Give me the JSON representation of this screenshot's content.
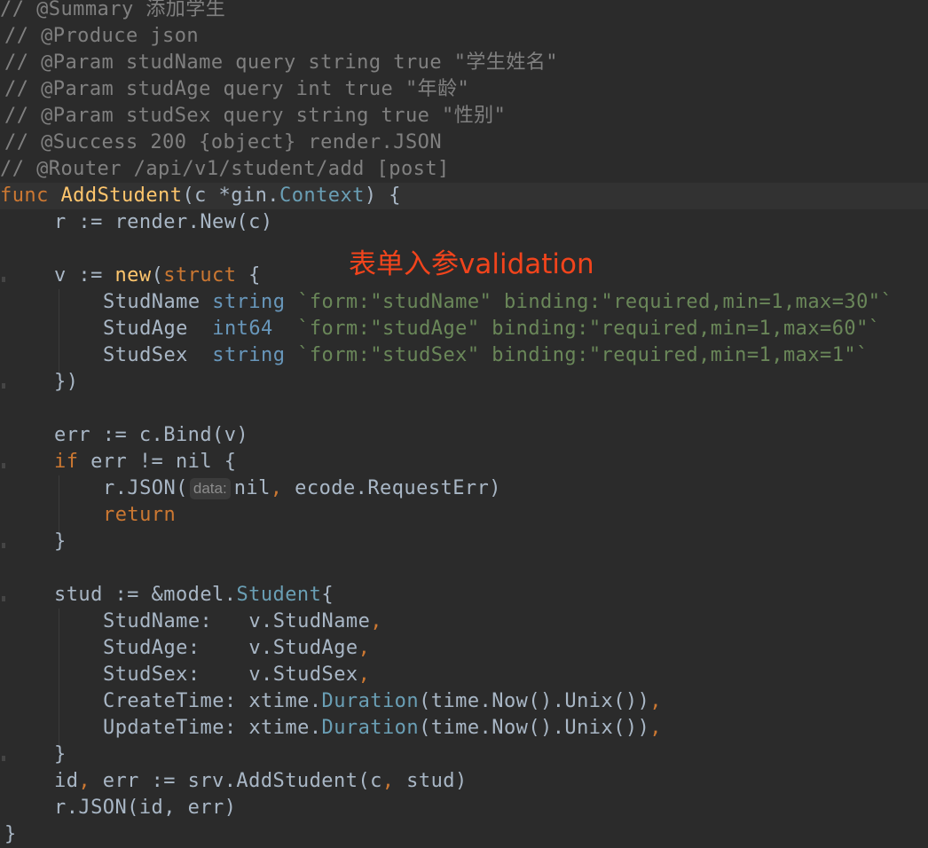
{
  "annotation": "表单入参validation",
  "comments": {
    "summary": "// @Summary 添加学生",
    "produce": "// @Produce json",
    "param_name": "// @Param studName query string true \"学生姓名\"",
    "param_age": "// @Param studAge query int true \"年龄\"",
    "param_sex": "// @Param studSex query string true \"性别\"",
    "success": "// @Success 200 {object} render.JSON",
    "router": "// @Router /api/v1/student/add [post]"
  },
  "code": {
    "func_kw": "func",
    "func_name": "AddStudent",
    "func_sig_1": "(c *gin.",
    "func_sig_type": "Context",
    "func_sig_2": ") {",
    "r_new": "r := render.New(c)",
    "v_prefix": "v := ",
    "new_kw": "new",
    "paren_open": "(",
    "struct_kw": "struct",
    "brace_open": " {",
    "f1_name": "StudName ",
    "f1_type": "string",
    "f1_tag": "`form:\"studName\" binding:\"required,min=1,max=30\"`",
    "f2_name": "StudAge  ",
    "f2_type": "int64",
    "f2_tag": "`form:\"studAge\" binding:\"required,min=1,max=60\"`",
    "f3_name": "StudSex  ",
    "f3_type": "string",
    "f3_tag": "`form:\"studSex\" binding:\"required,min=1,max=1\"`",
    "struct_close": "})",
    "err_bind": "err := c.Bind(v)",
    "if_kw": "if",
    "if_cond": " err != nil {",
    "json_call": "r.JSON(",
    "hint_data": "data:",
    "json_args_1": "nil",
    "comma": ",",
    "json_args_2": " ecode.RequestErr)",
    "return_kw": "return",
    "close_brace": "}",
    "stud_prefix": "stud := &model.",
    "stud_type": "Student",
    "stud_brace": "{",
    "a1_key": "StudName:   ",
    "a1_val": "v.StudName",
    "a2_key": "StudAge:    ",
    "a2_val": "v.StudAge",
    "a3_key": "StudSex:    ",
    "a3_val": "v.StudSex",
    "a4_key": "CreateTime: xtime.",
    "a4_fn": "Duration",
    "a4_rest": "(time.Now().Unix())",
    "a5_key": "UpdateTime: xtime.",
    "a5_fn": "Duration",
    "a5_rest": "(time.Now().Unix())",
    "id_prefix": "id",
    "id_rest": " err := srv.AddStudent(c",
    "id_tail": " stud)",
    "json_final": "r.JSON(id, err)",
    "func_close": "}"
  },
  "colors": {
    "background": "#2b2b2b",
    "comment": "#808080",
    "keyword": "#cc7832",
    "function": "#ffc66d",
    "string": "#6a8759",
    "annotation": "#f2441c"
  }
}
